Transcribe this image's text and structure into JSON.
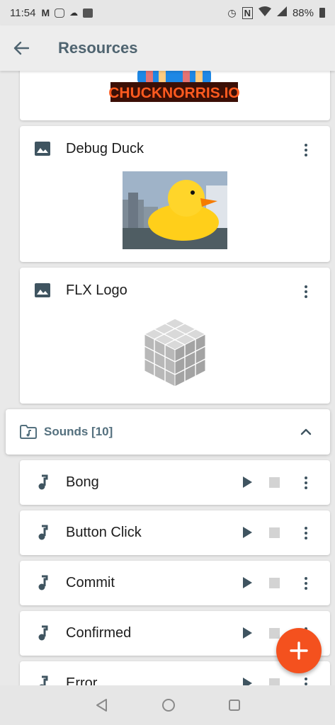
{
  "status_bar": {
    "time": "11:54",
    "battery": "88%"
  },
  "app_bar": {
    "title": "Resources",
    "back_icon": "arrow-back-icon"
  },
  "logo_card": {
    "text": "CHUCKNORRIS.IO"
  },
  "image_cards": [
    {
      "title": "Debug Duck",
      "icon": "image-icon"
    },
    {
      "title": "FLX Logo",
      "icon": "image-icon"
    }
  ],
  "sounds_group": {
    "label": "Sounds [10]",
    "icon": "music-folder-icon",
    "expanded": true
  },
  "sounds": [
    {
      "label": "Bong"
    },
    {
      "label": "Button Click"
    },
    {
      "label": "Commit"
    },
    {
      "label": "Confirmed"
    },
    {
      "label": "Error"
    }
  ],
  "colors": {
    "accent": "#f4511e",
    "title": "#4f6470",
    "icon": "#3f5460",
    "group": "#54707e"
  }
}
